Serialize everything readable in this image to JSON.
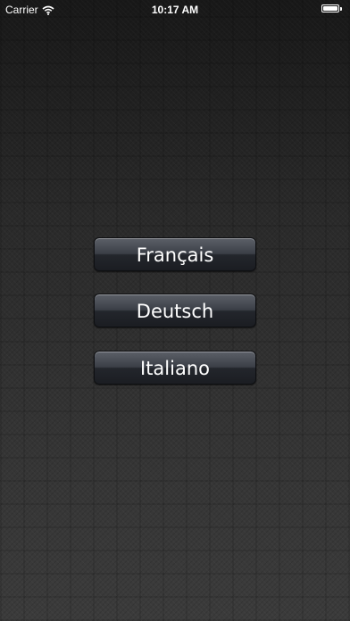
{
  "status_bar": {
    "carrier": "Carrier",
    "time": "10:17 AM",
    "battery_level": 1.0,
    "wifi_icon": "wifi-icon",
    "battery_icon": "battery-icon"
  },
  "languages": [
    {
      "label": "Français"
    },
    {
      "label": "Deutsch"
    },
    {
      "label": "Italiano"
    }
  ]
}
